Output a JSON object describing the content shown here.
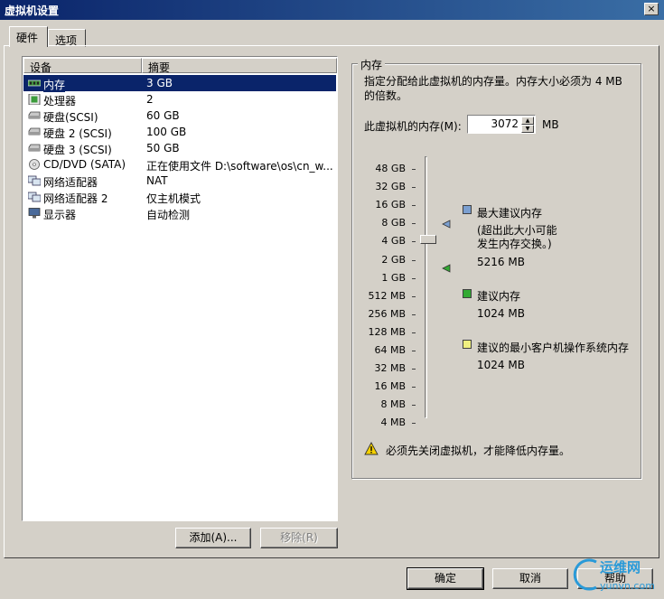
{
  "window": {
    "title": "虚拟机设置",
    "close_glyph": "×"
  },
  "tabs": [
    {
      "label": "硬件"
    },
    {
      "label": "选项"
    }
  ],
  "device_list": {
    "columns": {
      "device": "设备",
      "summary": "摘要"
    },
    "rows": [
      {
        "name": "内存",
        "summary": "3 GB",
        "icon": "memory-icon",
        "selected": true
      },
      {
        "name": "处理器",
        "summary": "2",
        "icon": "processor-icon"
      },
      {
        "name": "硬盘(SCSI)",
        "summary": "60 GB",
        "icon": "harddisk-icon"
      },
      {
        "name": "硬盘 2 (SCSI)",
        "summary": "100 GB",
        "icon": "harddisk-icon"
      },
      {
        "name": "硬盘 3 (SCSI)",
        "summary": "50 GB",
        "icon": "harddisk-icon"
      },
      {
        "name": "CD/DVD (SATA)",
        "summary": "正在使用文件 D:\\software\\os\\cn_w...",
        "icon": "cd-dvd-icon"
      },
      {
        "name": "网络适配器",
        "summary": "NAT",
        "icon": "network-adapter-icon"
      },
      {
        "name": "网络适配器 2",
        "summary": "仅主机模式",
        "icon": "network-adapter-icon"
      },
      {
        "name": "显示器",
        "summary": "自动检测",
        "icon": "display-icon"
      }
    ]
  },
  "buttons": {
    "add": "添加(A)...",
    "remove": "移除(R)",
    "ok": "确定",
    "cancel": "取消",
    "help": "帮助"
  },
  "memory": {
    "group_title": "内存",
    "description": "指定分配给此虚拟机的内存量。内存大小必须为 4 MB 的倍数。",
    "field_label": "此虚拟机的内存(M):",
    "value": "3072",
    "unit": "MB",
    "scale_labels": [
      "48 GB",
      "32 GB",
      "16 GB",
      "8 GB",
      "4 GB",
      "2 GB",
      "1 GB",
      "512 MB",
      "256 MB",
      "128 MB",
      "64 MB",
      "32 MB",
      "16 MB",
      "8 MB",
      "4 MB"
    ],
    "legend": [
      {
        "title": "最大建议内存",
        "note": "(超出此大小可能\n发生内存交换。)",
        "value": "5216 MB",
        "color": "#7b9fd0"
      },
      {
        "title": "建议内存",
        "value": "1024 MB",
        "color": "#33aa33"
      },
      {
        "title": "建议的最小客户机操作系统内存",
        "value": "1024 MB",
        "color": "#f0f080"
      }
    ],
    "warning": "必须先关闭虚拟机，才能降低内存量。"
  },
  "watermark": {
    "text1": "运维网",
    "text2": "yunvn.com"
  }
}
